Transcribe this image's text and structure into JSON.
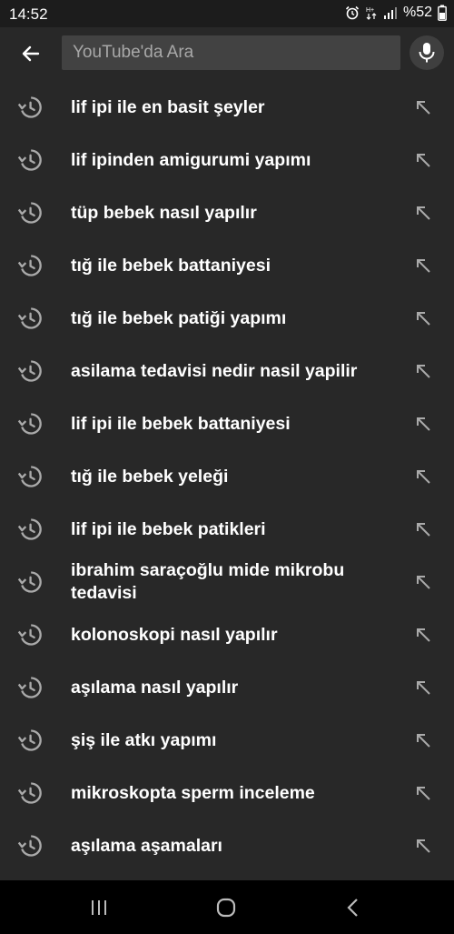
{
  "status_bar": {
    "time": "14:52",
    "battery": "%52",
    "icons": [
      "alarm-icon",
      "data-icon",
      "signal-icon",
      "battery-icon"
    ]
  },
  "search": {
    "placeholder": "YouTube'da Ara",
    "value": ""
  },
  "suggestions": [
    {
      "label": "lif ipi ile en basit şeyler"
    },
    {
      "label": "lif ipinden amigurumi yapımı"
    },
    {
      "label": "tüp bebek nasıl yapılır"
    },
    {
      "label": "tığ ile bebek battaniyesi"
    },
    {
      "label": "tığ ile bebek patiği yapımı"
    },
    {
      "label": "asilama tedavisi nedir nasil yapilir"
    },
    {
      "label": "lif ipi ile bebek battaniyesi"
    },
    {
      "label": "tığ ile bebek yeleği"
    },
    {
      "label": "lif ipi ile bebek patikleri"
    },
    {
      "label": "ibrahim saraçoğlu mide mikrobu tedavisi"
    },
    {
      "label": "kolonoskopi nasıl yapılır"
    },
    {
      "label": "aşılama nasıl yapılır"
    },
    {
      "label": "şiş ile atkı yapımı"
    },
    {
      "label": "mikroskopta sperm inceleme"
    },
    {
      "label": "aşılama aşamaları"
    }
  ],
  "icons": {
    "back": "back-arrow-icon",
    "mic": "microphone-icon",
    "history": "history-icon",
    "fill_query": "north-west-arrow-icon"
  },
  "colors": {
    "background": "#282828",
    "search_field": "#424242",
    "status_bar": "#1c1c1c",
    "nav_bar": "#000000",
    "icon_gray": "#aaaaaa"
  }
}
